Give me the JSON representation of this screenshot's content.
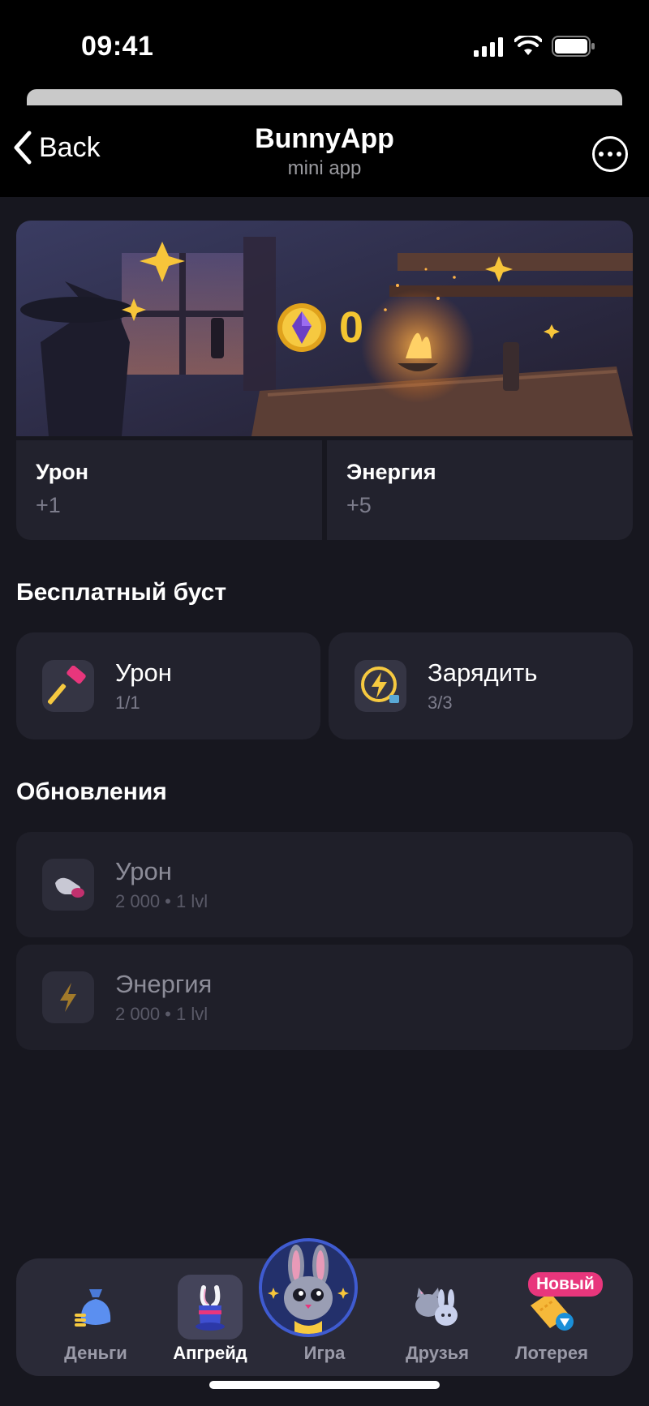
{
  "status_bar": {
    "time": "09:41"
  },
  "nav": {
    "back_label": "Back",
    "title": "BunnyApp",
    "subtitle": "mini app"
  },
  "hero": {
    "balance": "0"
  },
  "stats": [
    {
      "label": "Урон",
      "value": "+1"
    },
    {
      "label": "Энергия",
      "value": "+5"
    }
  ],
  "free_boost": {
    "title": "Бесплатный буст",
    "items": [
      {
        "title": "Урон",
        "sub": "1/1",
        "icon": "hammer-icon"
      },
      {
        "title": "Зарядить",
        "sub": "3/3",
        "icon": "lightning-charge-icon"
      }
    ]
  },
  "upgrades": {
    "title": "Обновления",
    "items": [
      {
        "title": "Урон",
        "sub": "2 000 • 1 lvl",
        "icon": "glove-icon"
      },
      {
        "title": "Энергия",
        "sub": "2 000 • 1 lvl",
        "icon": "lightning-icon"
      }
    ]
  },
  "tabbar": {
    "tabs": [
      {
        "label": "Деньги",
        "icon": "money-bag-icon"
      },
      {
        "label": "Апгрейд",
        "icon": "magic-hat-icon",
        "active": true
      },
      {
        "label": "Игра",
        "icon": "bunny-avatar-icon"
      },
      {
        "label": "Друзья",
        "icon": "friends-icon"
      },
      {
        "label": "Лотерея",
        "icon": "ticket-icon",
        "badge": "Новый"
      }
    ]
  },
  "colors": {
    "accent_gold": "#f4c531",
    "background": "#17171f",
    "card": "#22222d",
    "badge": "#e8367c"
  }
}
